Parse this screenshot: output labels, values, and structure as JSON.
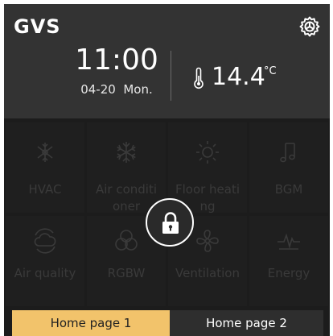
{
  "header": {
    "logo": "GVS",
    "time": "11:00",
    "date": "04-20",
    "weekday": "Mon.",
    "temperature": "14.4",
    "temperature_unit": "°C"
  },
  "functions": [
    {
      "label": "HVAC",
      "icon": "snowflake-sun-icon"
    },
    {
      "label": "Air conditi\noner",
      "icon": "snowflake-icon"
    },
    {
      "label": "Floor heati\nng",
      "icon": "sun-icon"
    },
    {
      "label": "BGM",
      "icon": "music-note-icon"
    },
    {
      "label": "Air quality",
      "icon": "cloud-refresh-icon"
    },
    {
      "label": "RGBW",
      "icon": "rgb-circles-icon"
    },
    {
      "label": "Ventilation",
      "icon": "fan-icon"
    },
    {
      "label": "Energy",
      "icon": "energy-pulse-icon"
    }
  ],
  "lock": {
    "icon": "lock-icon",
    "locked": true
  },
  "tabs": [
    {
      "label": "Home page 1",
      "active": true
    },
    {
      "label": "Home page 2",
      "active": false
    }
  ],
  "colors": {
    "active_tab": "#f2c36b",
    "header_bg": "#333333",
    "body_bg": "#1c1c1c"
  }
}
